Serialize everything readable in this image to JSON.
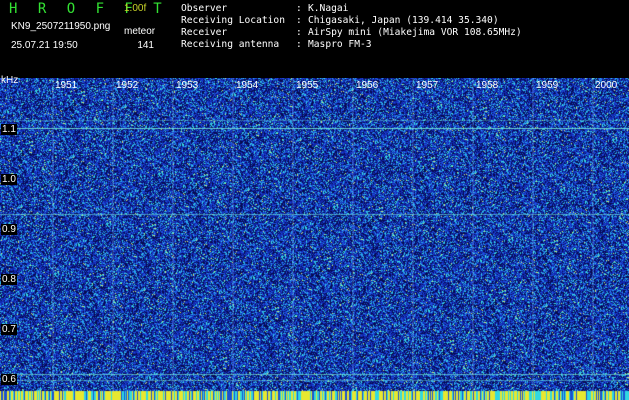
{
  "header": {
    "app_title": "H R O F F T",
    "version": "1.00f",
    "filename": "KN9_2507211950.png",
    "datetime": "25.07.21 19:50",
    "meteor_label": "meteor",
    "meteor_count": "141"
  },
  "info": [
    {
      "key": "Observer",
      "value": "K.Nagai"
    },
    {
      "key": "Receiving Location",
      "value": "Chigasaki, Japan (139.414 35.340)"
    },
    {
      "key": "Receiver",
      "value": "AirSpy mini (Miakejima VOR 108.65MHz)"
    },
    {
      "key": "Receiving antenna",
      "value": "Maspro FM-3"
    }
  ],
  "spectrogram": {
    "y_unit": "kHz",
    "y_ticks": [
      "1.1",
      "1.0",
      "0.9",
      "0.8",
      "0.7",
      "0.6"
    ],
    "time_ticks": [
      "1951",
      "1952",
      "1953",
      "1954",
      "1955",
      "1956",
      "1957",
      "1958",
      "1959",
      "2000"
    ]
  },
  "colors": {
    "background": "#000000",
    "plot_base": "#0a1a8a",
    "title_green": "#33e233",
    "noise_cyan": "#2ee8e0",
    "bottom_yellow": "#e8e830"
  }
}
